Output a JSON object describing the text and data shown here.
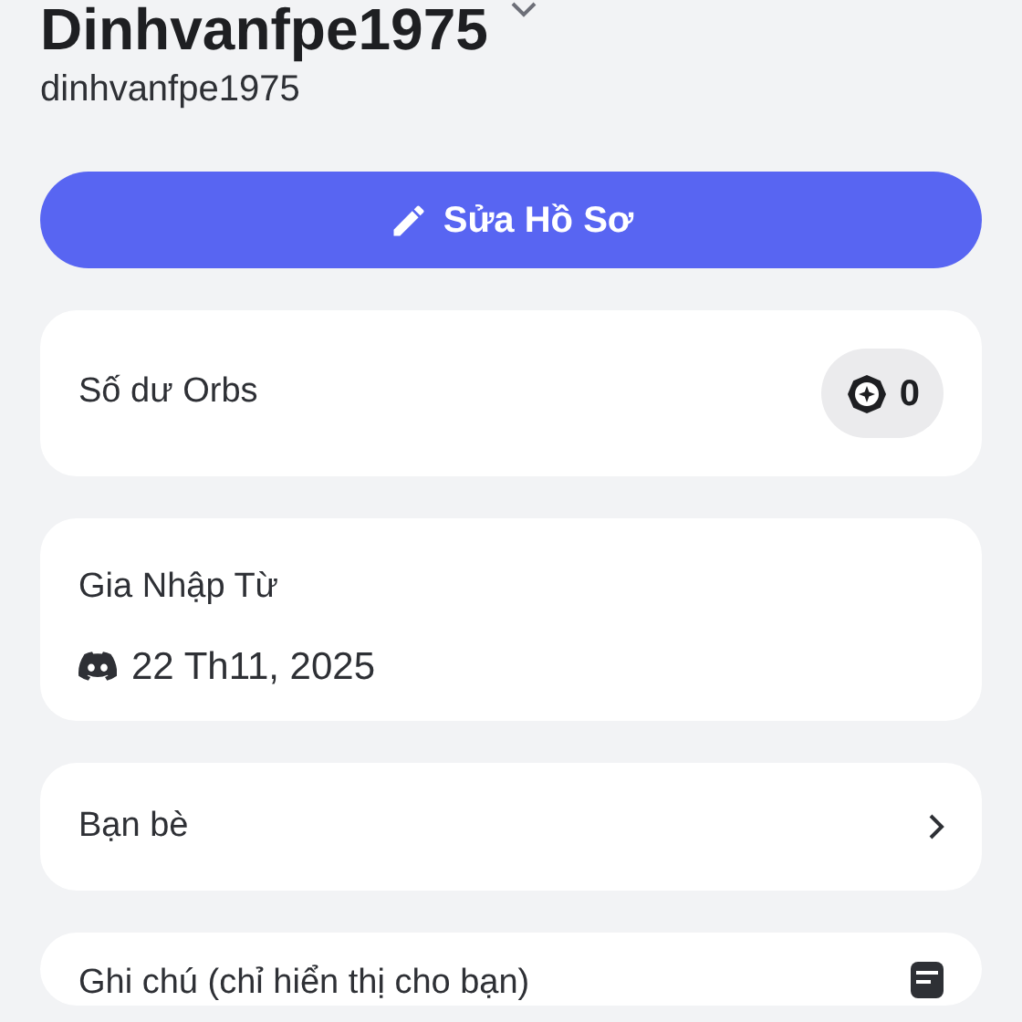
{
  "profile": {
    "display_name": "Dinhvanfpe1975",
    "username": "dinhvanfpe1975"
  },
  "edit_button": {
    "label": "Sửa Hồ Sơ"
  },
  "cards": [
    {
      "kind": "balance",
      "label": "Số dư Orbs",
      "value": "0"
    },
    {
      "kind": "joined",
      "label": "Gia Nhập Từ",
      "value": "22 Th11, 2025"
    },
    {
      "kind": "link",
      "label": "Bạn bè"
    },
    {
      "kind": "note",
      "label": "Ghi chú (chỉ hiển thị cho bạn)"
    }
  ]
}
